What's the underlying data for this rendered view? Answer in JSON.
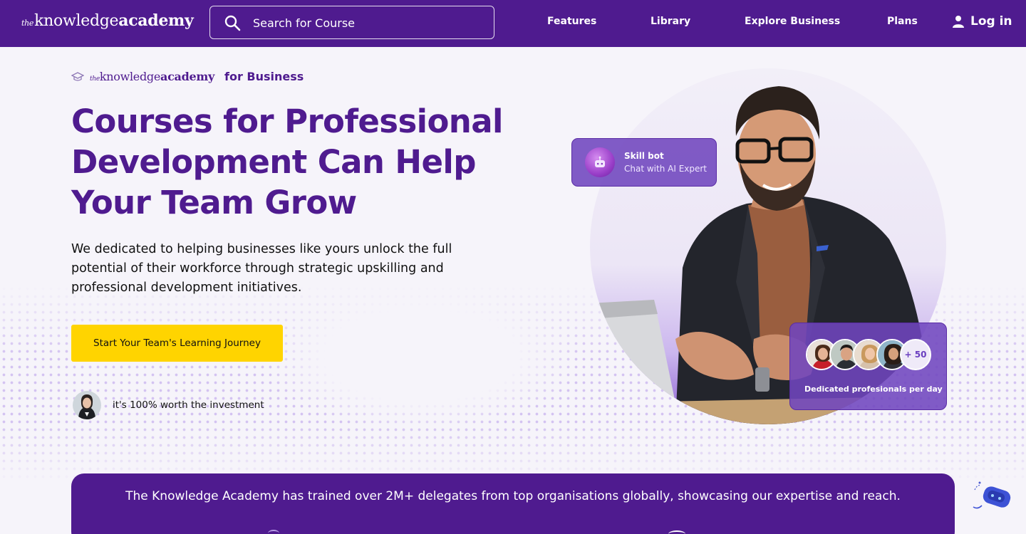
{
  "nav": {
    "logo": {
      "prefix": "the",
      "regular": "knowledge",
      "bold": "academy"
    },
    "search_placeholder": "Search for Course",
    "links": [
      "Features",
      "Library",
      "Explore Business",
      "Plans"
    ],
    "login_label": "Log in"
  },
  "hero": {
    "sub_brand": {
      "prefix": "the",
      "regular": "knowledge",
      "bold": "academy",
      "suffix": "for Business"
    },
    "headline_lines": [
      "Courses for Professional",
      "Development Can Help",
      "Your Team Grow"
    ],
    "description_lines": [
      "We dedicated to helping businesses like yours unlock the full",
      "potential of their workforce through strategic upskilling and",
      "professional development initiatives."
    ],
    "cta_label": "Start Your Team's Learning Journey",
    "testimonial_text": "it's 100% worth the investment"
  },
  "skillbot": {
    "title": "Skill bot",
    "subtitle": "Chat with AI Expert"
  },
  "professionals": {
    "more_label": "+ 50",
    "caption": "Dedicated profesionals per day"
  },
  "banner": {
    "text": "The Knowledge Academy has trained over 2M+ delegates from top organisations globally, showcasing our expertise and reach."
  },
  "colors": {
    "brand_purple": "#4f1b8f",
    "accent_yellow": "#ffd400",
    "card_purple": "#7046be"
  }
}
